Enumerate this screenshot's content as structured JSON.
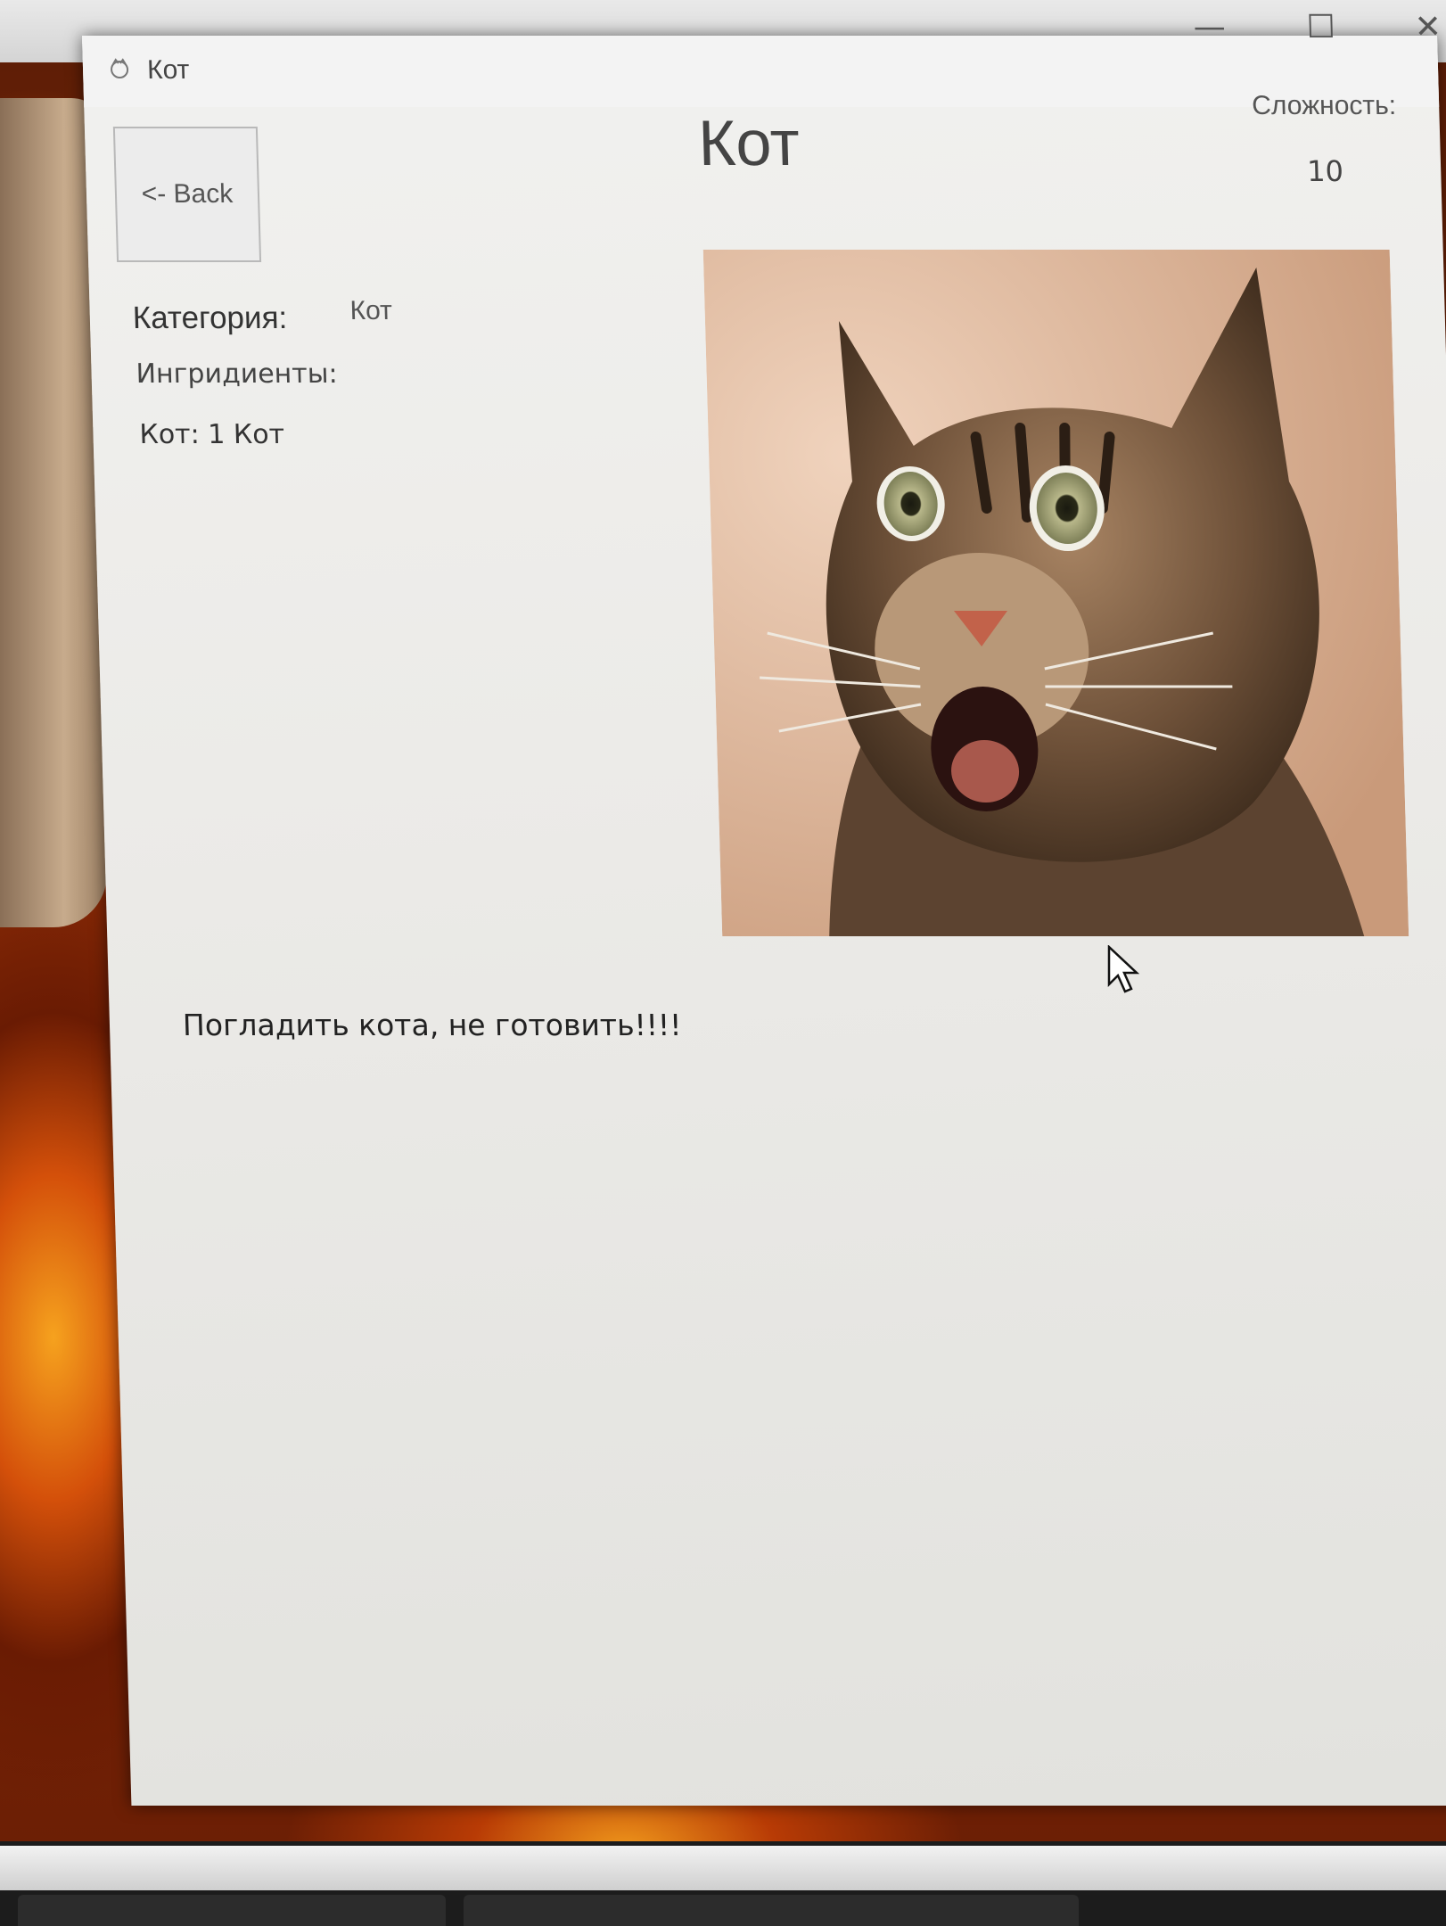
{
  "window": {
    "title": "Кот",
    "title_icon": "app-icon",
    "controls": {
      "minimize": "—",
      "maximize": "☐",
      "close": "✕"
    }
  },
  "header": {
    "back_label": "<- Back",
    "title": "Кот",
    "difficulty_label": "Сложность:",
    "difficulty_value": "10"
  },
  "details": {
    "category_label": "Категория:",
    "category_value": "Кот",
    "ingredients_label": "Ингридиенты:",
    "ingredients": [
      "Кот: 1 Кот"
    ]
  },
  "instructions": "Погладить кота, не готовить!!!!",
  "image": {
    "subject": "cat-photo"
  }
}
